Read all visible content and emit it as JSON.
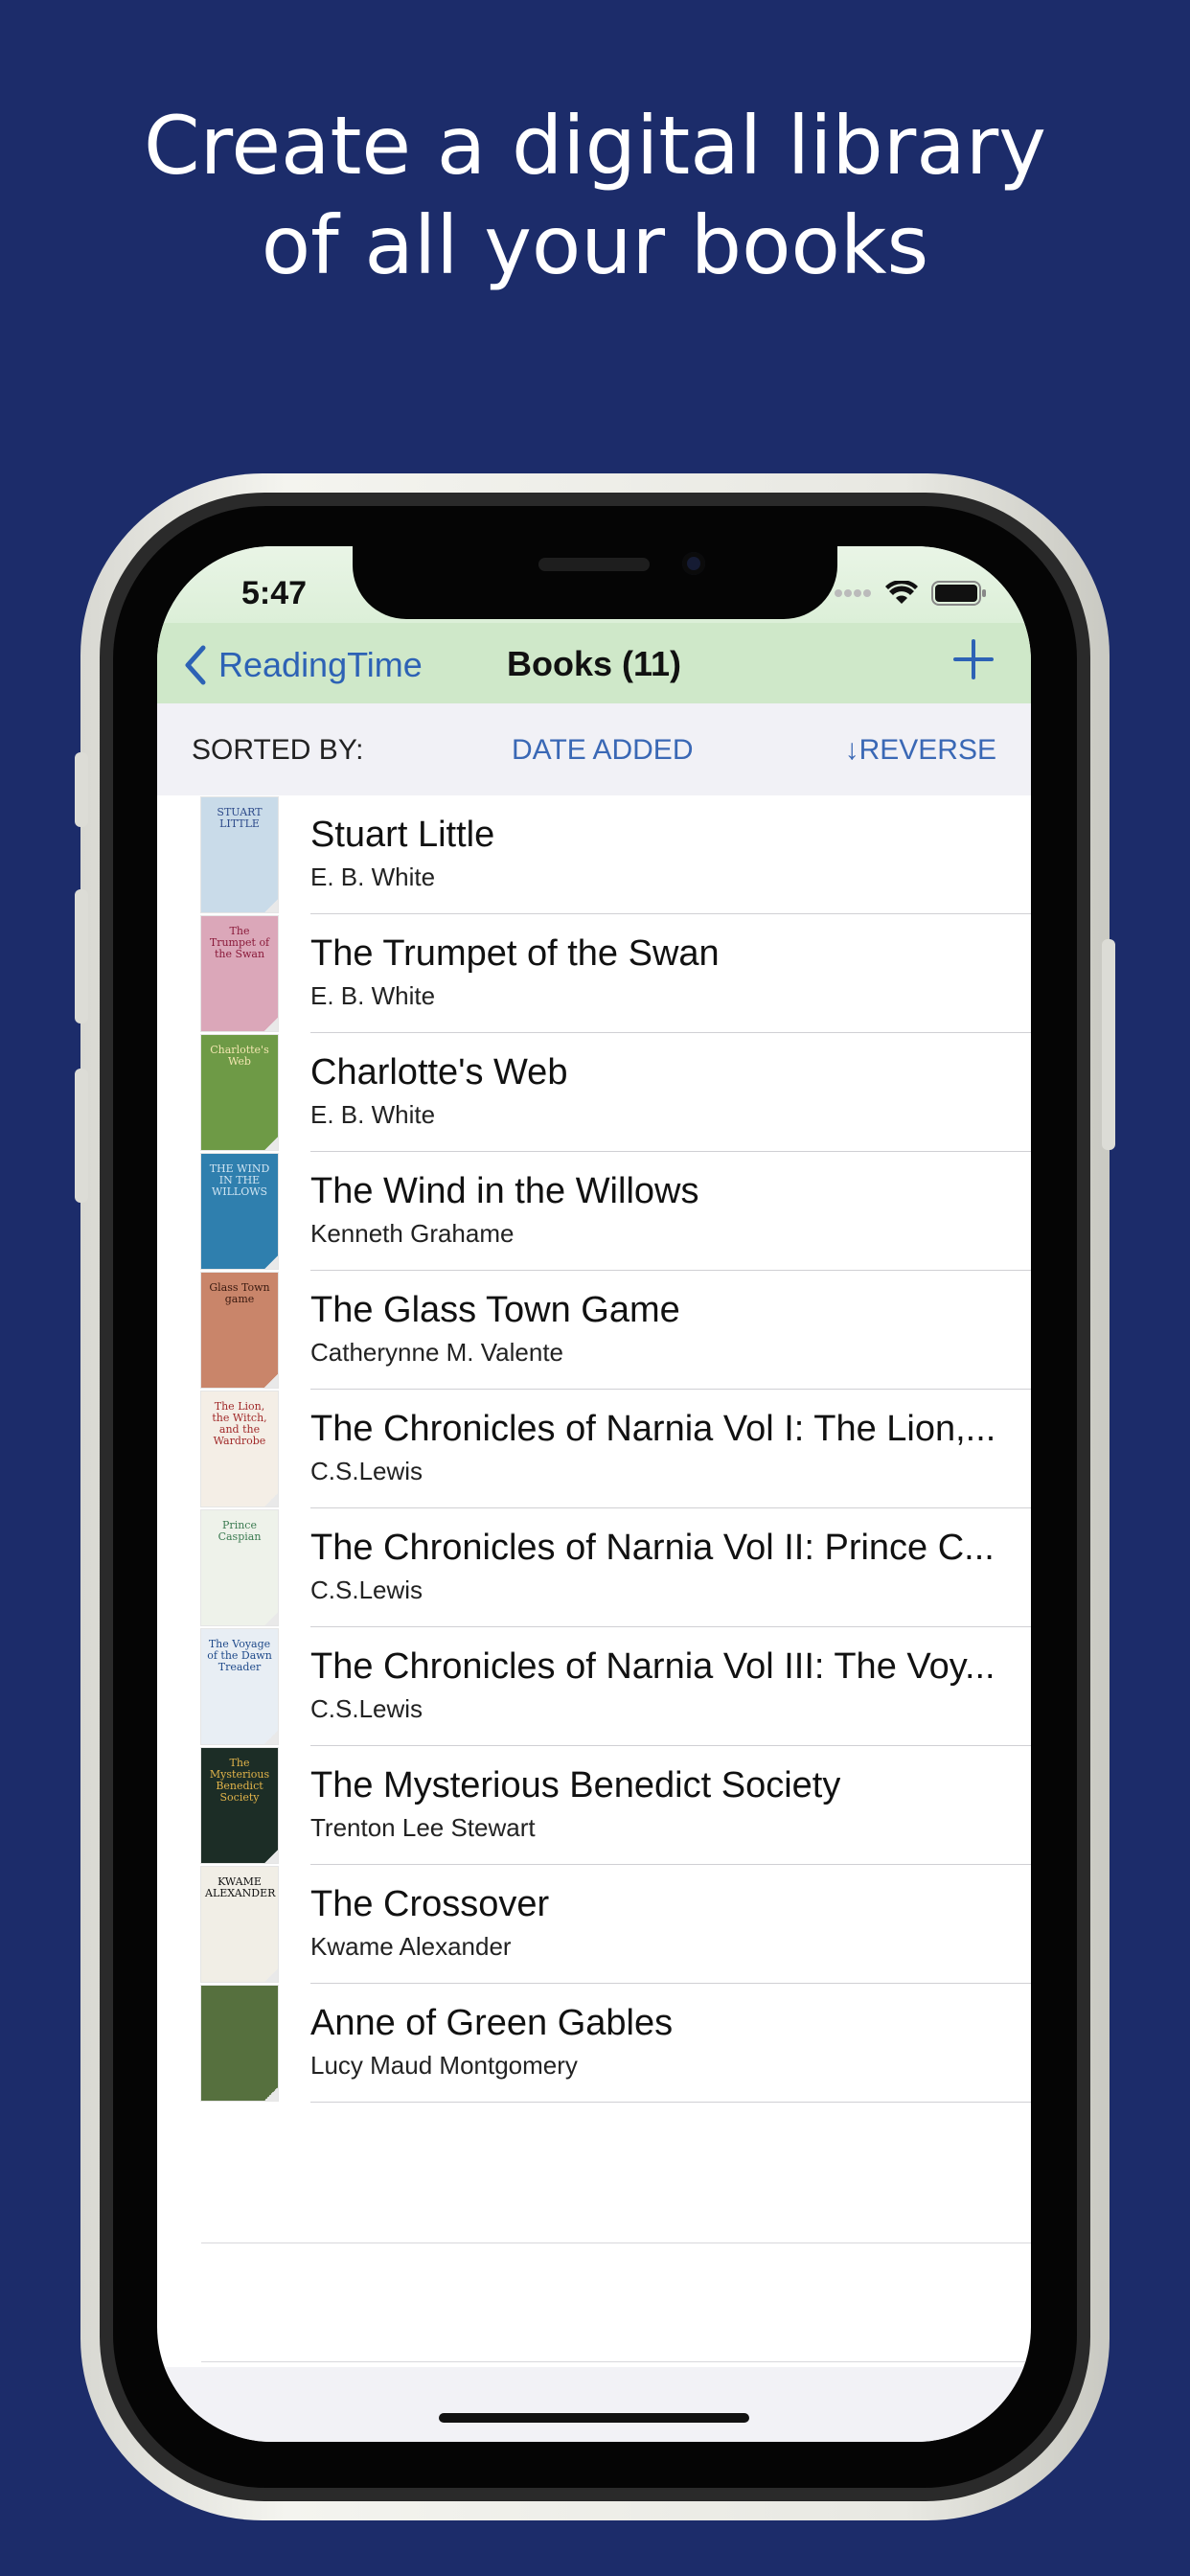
{
  "headline": {
    "line1": "Create a digital library",
    "line2": "of all your books"
  },
  "status_bar": {
    "time": "5:47"
  },
  "nav": {
    "back_label": "ReadingTime",
    "title": "Books (11)"
  },
  "sort_bar": {
    "label": "SORTED BY:",
    "field": "DATE ADDED",
    "reverse": "↓REVERSE"
  },
  "books": [
    {
      "title": "Stuart Little",
      "author": "E. B. White",
      "cover_text": "STUART LITTLE",
      "cover_color": "#c9dbe9",
      "cover_fg": "#2d4a8a"
    },
    {
      "title": "The Trumpet of the Swan",
      "author": "E. B. White",
      "cover_text": "The Trumpet of the Swan",
      "cover_color": "#dba7b9",
      "cover_fg": "#8a1a3a"
    },
    {
      "title": "Charlotte's Web",
      "author": "E. B. White",
      "cover_text": "Charlotte's Web",
      "cover_color": "#6e9a46",
      "cover_fg": "#f3e6b0"
    },
    {
      "title": "The Wind in the Willows",
      "author": "Kenneth Grahame",
      "cover_text": "THE WIND IN THE WILLOWS",
      "cover_color": "#2f7fae",
      "cover_fg": "#cfe4f2"
    },
    {
      "title": "The Glass Town Game",
      "author": "Catherynne M. Valente",
      "cover_text": "Glass Town game",
      "cover_color": "#c9856a",
      "cover_fg": "#3a1a10"
    },
    {
      "title": "The Chronicles of Narnia Vol I: The Lion,...",
      "author": "C.S.Lewis",
      "cover_text": "The Lion, the Witch, and the Wardrobe",
      "cover_color": "#f4eee6",
      "cover_fg": "#a12a2a"
    },
    {
      "title": "The Chronicles of Narnia Vol II: Prince C...",
      "author": "C.S.Lewis",
      "cover_text": "Prince Caspian",
      "cover_color": "#eef2ea",
      "cover_fg": "#3a7a50"
    },
    {
      "title": "The Chronicles of Narnia Vol III: The Voy...",
      "author": "C.S.Lewis",
      "cover_text": "The Voyage of the Dawn Treader",
      "cover_color": "#e8eef4",
      "cover_fg": "#1f4a8a"
    },
    {
      "title": "The Mysterious Benedict Society",
      "author": "Trenton Lee Stewart",
      "cover_text": "The Mysterious Benedict Society",
      "cover_color": "#1c2d26",
      "cover_fg": "#e2b44a"
    },
    {
      "title": "The Crossover",
      "author": "Kwame Alexander",
      "cover_text": "KWAME ALEXANDER",
      "cover_color": "#f1eee6",
      "cover_fg": "#111111"
    },
    {
      "title": "Anne of Green Gables",
      "author": "Lucy Maud Montgomery",
      "cover_text": "",
      "cover_color": "#56703e",
      "cover_fg": "#e9e2c8"
    }
  ],
  "colors": {
    "background": "#1c2c6a",
    "nav_green": "#cfe8c9",
    "accent_blue": "#2d62b5"
  }
}
